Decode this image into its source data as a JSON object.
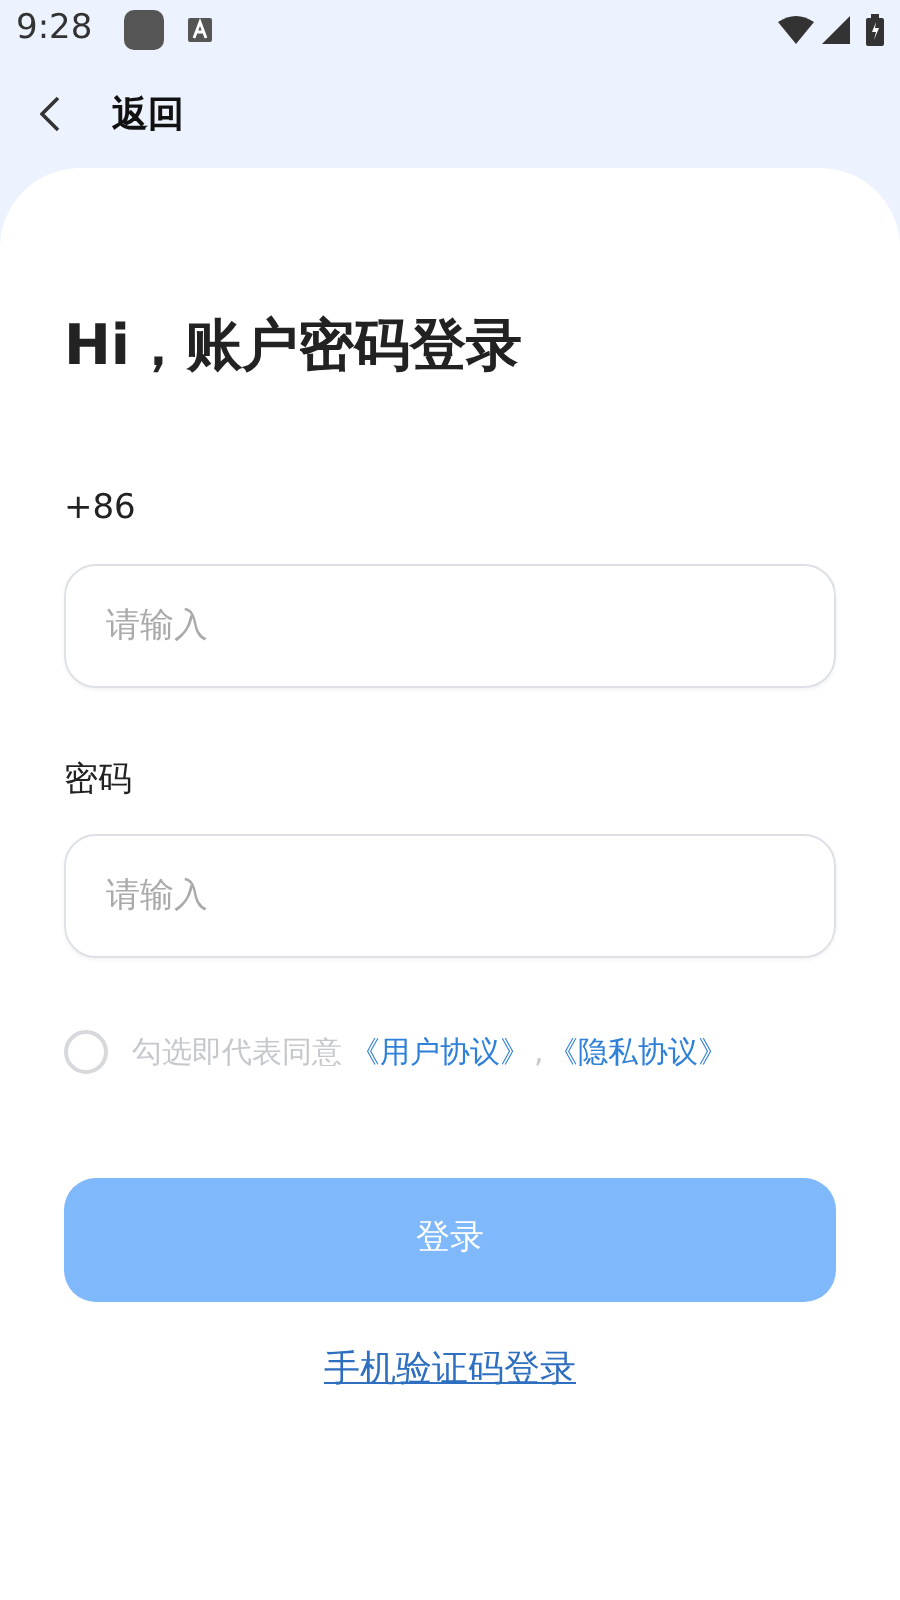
{
  "status_bar": {
    "time": "9:28"
  },
  "header": {
    "back_label": "返回"
  },
  "title": "Hi，账户密码登录",
  "fields": [
    {
      "label": "+86",
      "placeholder": "请输入"
    },
    {
      "label": "密码",
      "placeholder": "请输入"
    }
  ],
  "agreement": {
    "checked": false,
    "text": "勾选即代表同意",
    "links": [
      "《用户协议》",
      "《隐私协议》"
    ],
    "separator": ","
  },
  "login_button": {
    "label": "登录",
    "disabled": true
  },
  "alt_login_link": "手机验证码登录"
}
